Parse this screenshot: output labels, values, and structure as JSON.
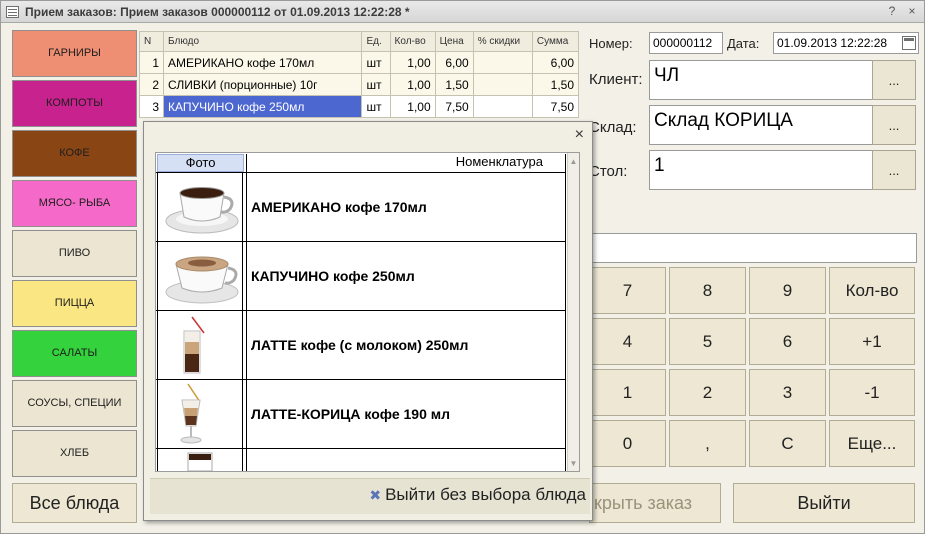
{
  "window": {
    "title": "Прием заказов: Прием заказов 000000112 от 01.09.2013 12:22:28 *",
    "help_glyph": "?",
    "close_glyph": "×"
  },
  "categories": [
    {
      "label": "ГАРНИРЫ",
      "color": "#ee8f74"
    },
    {
      "label": "КОМПОТЫ",
      "color": "#c8228e"
    },
    {
      "label": "КОФЕ",
      "color": "#8a4515"
    },
    {
      "label": "МЯСО- РЫБА",
      "color": "#f56ac8"
    },
    {
      "label": "ПИВО",
      "color": "#ece5d2"
    },
    {
      "label": "ПИЦЦА",
      "color": "#fae682"
    },
    {
      "label": "САЛАТЫ",
      "color": "#34d23c"
    },
    {
      "label": "СОУСЫ, СПЕЦИИ",
      "color": "#ece5d2"
    },
    {
      "label": "ХЛЕБ",
      "color": "#ece5d2"
    }
  ],
  "all_dishes_label": "Все блюда",
  "order_table": {
    "headers": [
      "N",
      "Блюдо",
      "Ед.",
      "Кол-во",
      "Цена",
      "% скидки",
      "Сумма"
    ],
    "rows": [
      {
        "n": "1",
        "dish": "АМЕРИКАНО кофе 170мл",
        "unit": "шт",
        "qty": "1,00",
        "price": "6,00",
        "discount": "",
        "sum": "6,00"
      },
      {
        "n": "2",
        "dish": "СЛИВКИ (порционные) 10г",
        "unit": "шт",
        "qty": "1,00",
        "price": "1,50",
        "discount": "",
        "sum": "1,50"
      },
      {
        "n": "3",
        "dish": "КАПУЧИНО кофе 250мл",
        "unit": "шт",
        "qty": "1,00",
        "price": "7,50",
        "discount": "",
        "sum": "7,50"
      }
    ]
  },
  "header_fields": {
    "number_label": "Номер:",
    "number_value": "000000112",
    "date_label": "Дата:",
    "date_value": "01.09.2013 12:22:28",
    "client_label": "Клиент:",
    "client_value": "ЧЛ",
    "warehouse_label": "Склад:",
    "warehouse_value": "Склад КОРИЦА",
    "table_label": "Стол:",
    "table_value": "1",
    "select_glyph": "..."
  },
  "keypad": {
    "keys": [
      "7",
      "8",
      "9",
      "Кол-во",
      "4",
      "5",
      "6",
      "+1",
      "1",
      "2",
      "3",
      "-1",
      "0",
      ",",
      "C",
      "Еще..."
    ]
  },
  "bottom_buttons": {
    "close_order_partial": "крыть заказ",
    "exit": "Выйти"
  },
  "popup": {
    "close_glyph": "×",
    "col_photo": "Фото",
    "col_name": "Номенклатура",
    "items": [
      {
        "name": "АМЕРИКАНО кофе 170мл",
        "icon": "americano-cup-icon"
      },
      {
        "name": "КАПУЧИНО кофе 250мл",
        "icon": "cappuccino-cup-icon"
      },
      {
        "name": "ЛАТТЕ кофе (с молоком) 250мл",
        "icon": "latte-glass-icon"
      },
      {
        "name": "ЛАТТЕ-КОРИЦА кофе 190 мл",
        "icon": "latte-cinnamon-glass-icon"
      },
      {
        "name": "",
        "icon": "cup-icon"
      }
    ],
    "exit_without_select": "Выйти без выбора блюда"
  }
}
